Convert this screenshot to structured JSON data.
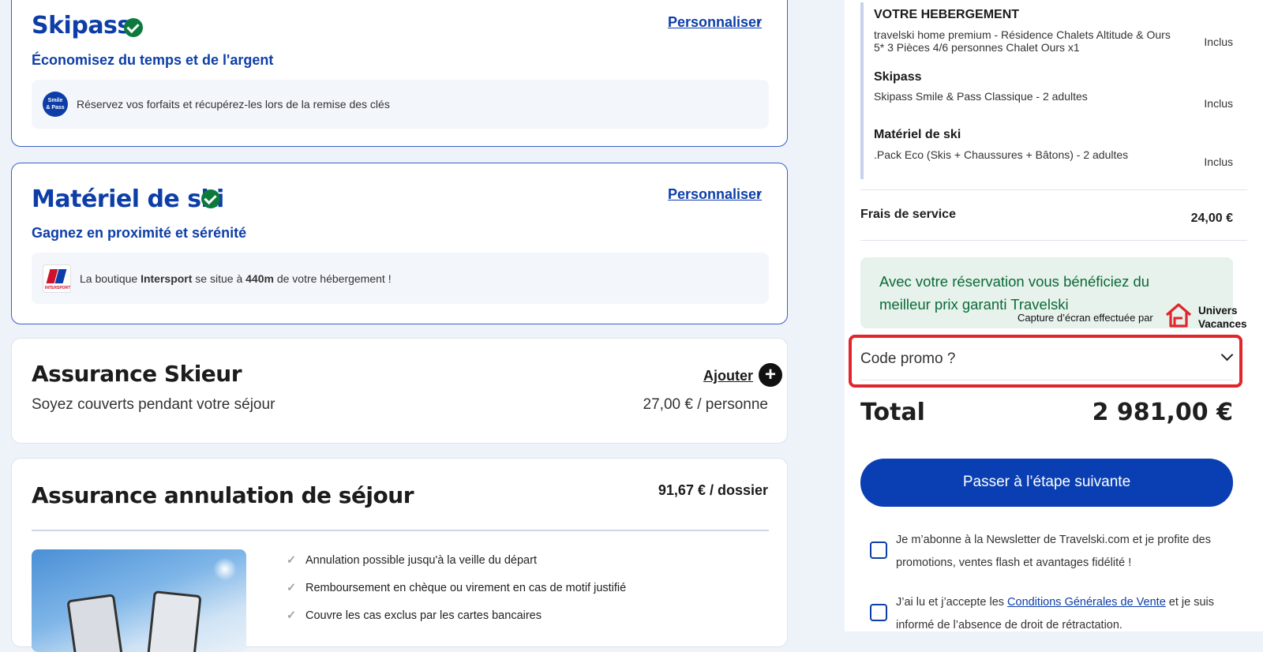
{
  "skipass_card": {
    "title": "Skipass",
    "personalize": "Personnaliser",
    "subtitle": "Économisez du temps et de l'argent",
    "logo_text_1": "Smile",
    "logo_text_2": "& Pass",
    "info": "Réservez vos forfaits et récupérez-les lors de la remise des clés"
  },
  "ski_gear_card": {
    "title": "Matériel de ski",
    "personalize": "Personnaliser",
    "subtitle": "Gagnez en proximité et sérénité",
    "logo_text": "INTERSPORT",
    "info_prefix": "La boutique ",
    "info_brand": "Intersport",
    "info_mid": " se situe à ",
    "info_distance": "440m",
    "info_suffix": " de votre hébergement !"
  },
  "insurance_skier": {
    "title": "Assurance Skieur",
    "add_label": "Ajouter",
    "description": "Soyez couverts pendant votre séjour",
    "price": "27,00 € / personne"
  },
  "insurance_cancel": {
    "title": "Assurance annulation de séjour",
    "price": "91,67 € / dossier",
    "benefits": [
      "Annulation possible jusqu'à la veille du départ",
      "Remboursement en chèque ou virement en cas de motif justifié",
      "Couvre les cas exclus par les cartes bancaires"
    ]
  },
  "summary": {
    "accommodation_title": "VOTRE HEBERGEMENT",
    "accommodation_desc": "travelski home premium - Résidence Chalets Altitude & Ours 5* 3 Pièces 4/6 personnes Chalet Ours x1",
    "accommodation_status": "Inclus",
    "skipass_title": "Skipass",
    "skipass_desc": "Skipass Smile & Pass Classique - 2 adultes",
    "skipass_status": "Inclus",
    "gear_title": "Matériel de ski",
    "gear_desc": ".Pack Eco (Skis + Chaussures + Bâtons) - 2 adultes",
    "gear_status": "Inclus",
    "service_fee_label": "Frais de service",
    "service_fee_value": "24,00 €",
    "guarantee_text": "Avec votre réservation vous bénéficiez du meilleur prix garanti Travelski",
    "promo_label": "Code promo ?",
    "total_label": "Total",
    "total_value": "2 981,00 €",
    "next_button": "Passer à l’étape suivante",
    "newsletter_text": "Je m’abonne à la Newsletter de Travelski.com et je profite des promotions, ventes flash et avantages fidélité !",
    "cgv_prefix": "J’ai lu et j’accepte les ",
    "cgv_link": "Conditions Générales de Vente",
    "cgv_suffix": " et je suis informé de l’absence de droit de rétractation."
  },
  "watermark": {
    "caption": "Capture d’écran effectuée par",
    "brand_line1": "Univers",
    "brand_line2": "Vacances"
  },
  "colors": {
    "brand_blue": "#0d3ea8",
    "highlight_red": "#e0252b",
    "success_green": "#0b7a3c"
  }
}
